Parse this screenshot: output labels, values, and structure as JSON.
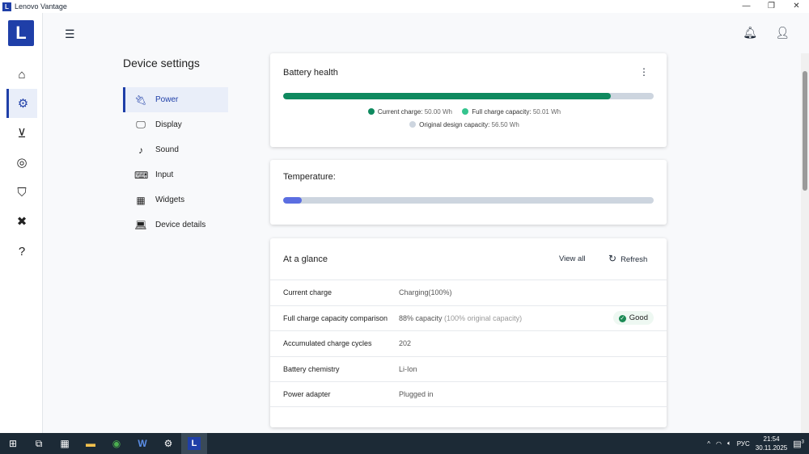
{
  "window": {
    "title": "Lenovo Vantage",
    "logo": "L",
    "minimize": "—",
    "restore": "❐",
    "close": "✕"
  },
  "rail": {
    "logo": "L",
    "items": [
      {
        "name": "home-icon",
        "glyph": "⌂"
      },
      {
        "name": "gear-icon",
        "glyph": "⚙"
      },
      {
        "name": "download-icon",
        "glyph": "⊻"
      },
      {
        "name": "gaming-icon",
        "glyph": "◎"
      },
      {
        "name": "shield-icon",
        "glyph": "⛉"
      },
      {
        "name": "tools-icon",
        "glyph": "✖"
      },
      {
        "name": "help-icon",
        "glyph": "?"
      }
    ]
  },
  "header": {
    "menu_glyph": "☰",
    "bell_glyph": "🔔︎",
    "user_glyph": "👤︎"
  },
  "settings": {
    "title": "Device settings",
    "items": [
      {
        "label": "Power",
        "glyph": "🔌︎"
      },
      {
        "label": "Display",
        "glyph": "🖵"
      },
      {
        "label": "Sound",
        "glyph": "♪"
      },
      {
        "label": "Input",
        "glyph": "⌨"
      },
      {
        "label": "Widgets",
        "glyph": "▦"
      },
      {
        "label": "Device details",
        "glyph": "💻︎"
      }
    ]
  },
  "battery": {
    "title": "Battery health",
    "menu_glyph": "⋮",
    "fill_percent": 88.5,
    "current_label": "Current charge:",
    "current_value": "50.00 Wh",
    "full_label": "Full charge capacity:",
    "full_value": "50.01 Wh",
    "design_label": "Original design capacity:",
    "design_value": "56.50 Wh",
    "colors": {
      "current": "#0f8a5f",
      "full": "#35c48e",
      "design": "#cdd5df"
    }
  },
  "temperature": {
    "title": "Temperature:",
    "fill_percent": 5,
    "color": "#5b6ee1"
  },
  "glance": {
    "title": "At a glance",
    "view_all": "View all",
    "refresh": "Refresh",
    "refresh_glyph": "↻",
    "rows": [
      {
        "key": "Current charge",
        "value": "Charging(100%)",
        "extra": ""
      },
      {
        "key": "Full charge capacity comparison",
        "value": "88% capacity",
        "extra": "(100% original capacity)",
        "badge": "Good"
      },
      {
        "key": "Accumulated charge cycles",
        "value": "202",
        "extra": ""
      },
      {
        "key": "Battery chemistry",
        "value": "Li-Ion",
        "extra": ""
      },
      {
        "key": "Power adapter",
        "value": "Plugged in",
        "extra": ""
      }
    ]
  },
  "taskbar": {
    "apps": [
      "⊞",
      "⧉",
      "▦",
      "▬",
      "◉",
      "W",
      "⚙",
      "L"
    ],
    "tray": {
      "chevron": "^",
      "wifi": "◠",
      "volume": "🔈︎",
      "lang": "РУС",
      "time": "21:54",
      "date": "30.11.2025",
      "notifications": "3"
    }
  }
}
